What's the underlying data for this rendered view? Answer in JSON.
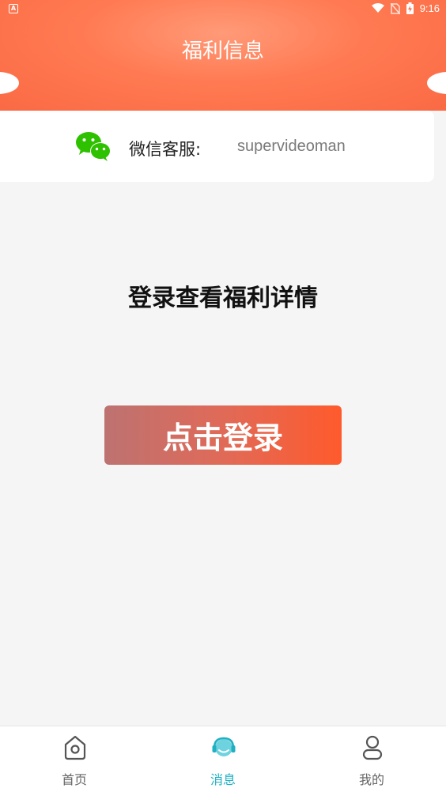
{
  "status_bar": {
    "time": "9:16",
    "left_icon": "A",
    "icons": [
      "wifi-icon",
      "no-sim-icon",
      "battery-charging-icon"
    ]
  },
  "header": {
    "title": "福利信息",
    "color": "#fa6a44"
  },
  "wechat": {
    "label": "微信客服:",
    "account": "supervideoman",
    "icon": "wechat-icon",
    "icon_color": "#2dc100"
  },
  "main": {
    "prompt": "登录查看福利详情",
    "login_button": "点击登录",
    "button_gradient": [
      "#bd7271",
      "#ff5a2c"
    ]
  },
  "bottom_nav": {
    "active_color": "#1fb0c2",
    "items": [
      {
        "label": "首页",
        "icon": "home-icon",
        "active": false
      },
      {
        "label": "消息",
        "icon": "headset-icon",
        "active": true
      },
      {
        "label": "我的",
        "icon": "person-icon",
        "active": false
      }
    ]
  }
}
